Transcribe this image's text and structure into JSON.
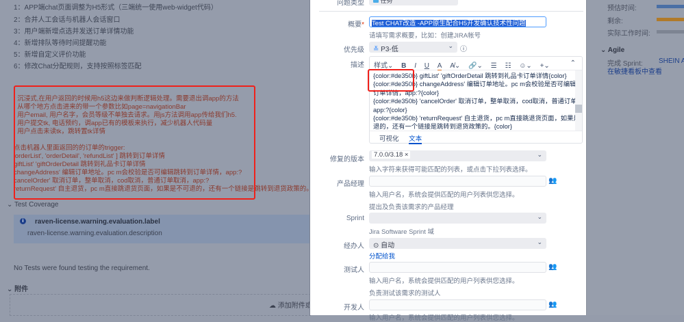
{
  "background": {
    "requirements": [
      "1：APP端chat页面调整为H5形式（三端统一使用web-widget代码）",
      "2：合并人工会话与机器人会话窗口",
      "3：用户端新增点选并发送订单详情功能",
      "4：新增排队等待时间提醒功能",
      "5：新增自定义评价功能",
      "6：修改Chat分配规则，支持按照标签匹配"
    ],
    "notes": [
      ". 沉浸式,在用户返回的时候用h5这边来做判断逻辑处理。需要退出调app的方法",
      ". 从哪个地方点击进来的带一个参数比如page=navigationBar",
      ". 用户email, 用户名字，会员等级不单独去请求。用js方法调用app传给我们h5.",
      ". 用户提交tk, 电话预约，调app已有的模板来执行，减少机器人代码量",
      ". 用户点击未读tk，跳转置tk详情",
      ".",
      "点击机器人里面返回的的订单的trigger:",
      "'orderList', 'orderDetail', 'refundList' ] 跳转到订单详情",
      "giftList' 'giftOrderDetail 跳转到礼品卡订单详情",
      "changeAddress' 编辑订单地址。pc m会校验是否可编辑跳转到订单详情，app:?",
      "cancelOrder' 取消订单，整单取消，cod取消，普通订单取消，app:?",
      "returnRequest' 自主退货，pc m直接跳退货页面，如果是不可退的，还有一个链接是跳转到退货政策的。"
    ],
    "test_coverage": {
      "title": "Test Coverage",
      "warning_label": "raven-license.warning.evaluation.label",
      "warning_desc": "raven-license.warning.evaluation.description",
      "empty": "No Tests were found testing the requirement."
    },
    "attachments": {
      "title": "附件",
      "drop": "添加附件或"
    }
  },
  "modal": {
    "issue_type": {
      "label": "问题类型",
      "value": "任务"
    },
    "summary": {
      "label": "概要",
      "value": "Test  CHAT改造 -APP原生配合H5开发确认技术性问题",
      "help": "请填写需求概要，比如：创建JIRA帐号"
    },
    "priority": {
      "label": "优先级",
      "value": "P3-低"
    },
    "description": {
      "label": "描述",
      "toolbar": {
        "style": "样式",
        "bold": "B",
        "italic": "I",
        "underline": "U",
        "color": "A"
      },
      "lines": [
        "{color:#de350b} giftList' 'giftOrderDetail 跳转到礼品卡订单详情{color}",
        "{color:#de350b} changeAddress' 编辑订单地址。pc m会校验是否可编辑跳转到",
        "订单详情，app:?{color}",
        "{color:#de350b} 'cancelOrder' 取消订单，整单取消，cod取消，普通订单取消，",
        "app:?{color}",
        "{color:#de350b} 'returnRequest' 自主退货，pc m直接跳退货页面，如果是不可",
        "退的，还有一个链接是跳转到退货政策的。{color}"
      ],
      "tabs": [
        "可视化",
        "文本"
      ]
    },
    "fix_version": {
      "label": "修复的版本",
      "value": "7.0.0/3.18",
      "help": "输入字符来获得可能匹配的列表，或点击下拉列表选择。"
    },
    "product_manager": {
      "label": "产品经理",
      "help1": "输入用户名，系统会提供匹配的用户列表供您选择。",
      "help2": "提出及负责该需求的产品经理"
    },
    "sprint": {
      "label": "Sprint",
      "help": "Jira Software Sprint 域"
    },
    "assignee": {
      "label": "经办人",
      "value": "自动",
      "assign_me": "分配给我"
    },
    "tester": {
      "label": "测试人",
      "help1": "输入用户名，系统会提供匹配的用户列表供您选择。",
      "help2": "负责测试该需求的测试人"
    },
    "developer": {
      "label": "开发人",
      "help1": "输入用户名，系统会提供匹配的用户列表供您选择。"
    }
  },
  "right": {
    "estimated": "预估时间:",
    "remaining": "剩余:",
    "logged": "实际工作时间:",
    "agile": "Agile",
    "sprint_label": "完成 Sprint:",
    "sprint_value": "SHEIN APP",
    "board_link": "在敏捷看板中查看",
    "colors": {
      "estimated": "#4a6fa5",
      "remaining": "#b07a2a",
      "logged": "#7d8492"
    }
  }
}
